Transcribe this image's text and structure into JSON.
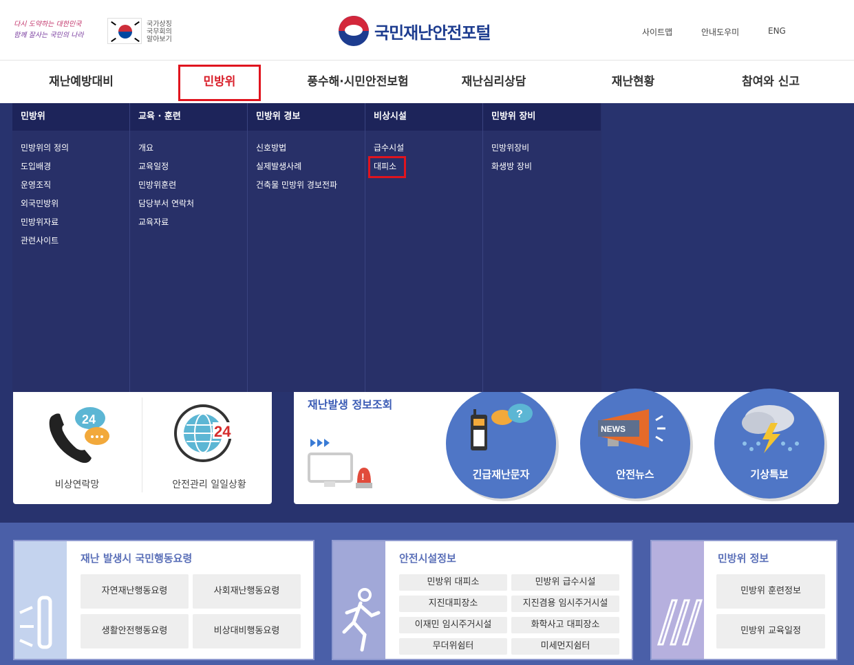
{
  "header": {
    "slogan_line1": "다시 도약하는 대한민국",
    "slogan_line2": "함께 잘사는 국민의 나라",
    "national_symbol": [
      "국가상징",
      "국무회의",
      "알아보기"
    ],
    "logo_text": "국민재난안전포털",
    "utils": [
      "사이트맵",
      "안내도우미",
      "ENG"
    ]
  },
  "gnb": [
    "재난예방대비",
    "민방위",
    "풍수해·시민안전보험",
    "재난심리상담",
    "재난현황",
    "참여와 신고"
  ],
  "mega_menu": [
    {
      "title": "민방위",
      "links": [
        "민방위의 정의",
        "도입배경",
        "운영조직",
        "외국민방위",
        "민방위자료",
        "관련사이트"
      ]
    },
    {
      "title": "교육 · 훈련",
      "links": [
        "개요",
        "교육일정",
        "민방위훈련",
        "담당부서 연락처",
        "교육자료"
      ]
    },
    {
      "title": "민방위 경보",
      "links": [
        "신호방법",
        "실제발생사례",
        "건축물 민방위 경보전파"
      ]
    },
    {
      "title": "비상시설",
      "links": [
        "급수시설",
        "대피소"
      ]
    },
    {
      "title": "민방위 장비",
      "links": [
        "민방위장비",
        "화생방 장비"
      ]
    }
  ],
  "quick": {
    "contact_label": "비상연락망",
    "daily_label": "안전관리 일일상황",
    "icon_number": "24"
  },
  "info": {
    "title": "재난발생 정보조회",
    "circles": [
      "긴급재난문자",
      "안전뉴스",
      "기상특보"
    ],
    "news_badge": "NEWS"
  },
  "bottom": {
    "conduct": {
      "title": "재난 발생시 국민행동요령",
      "buttons": [
        "자연재난행동요령",
        "사회재난행동요령",
        "생활안전행동요령",
        "비상대비행동요령"
      ]
    },
    "facility": {
      "title": "안전시설정보",
      "buttons": [
        "민방위 대피소",
        "민방위 급수시설",
        "지진대피장소",
        "지진겸용 임시주거시설",
        "이재민 임시주거시설",
        "화학사고 대피장소",
        "무더위쉼터",
        "미세먼지쉼터"
      ]
    },
    "civil": {
      "title": "민방위 정보",
      "buttons": [
        "민방위 훈련정보",
        "민방위 교육일정"
      ]
    }
  },
  "colors": {
    "navy": "#283068",
    "accent_red": "#e0141e",
    "blue": "#4f76c6"
  }
}
